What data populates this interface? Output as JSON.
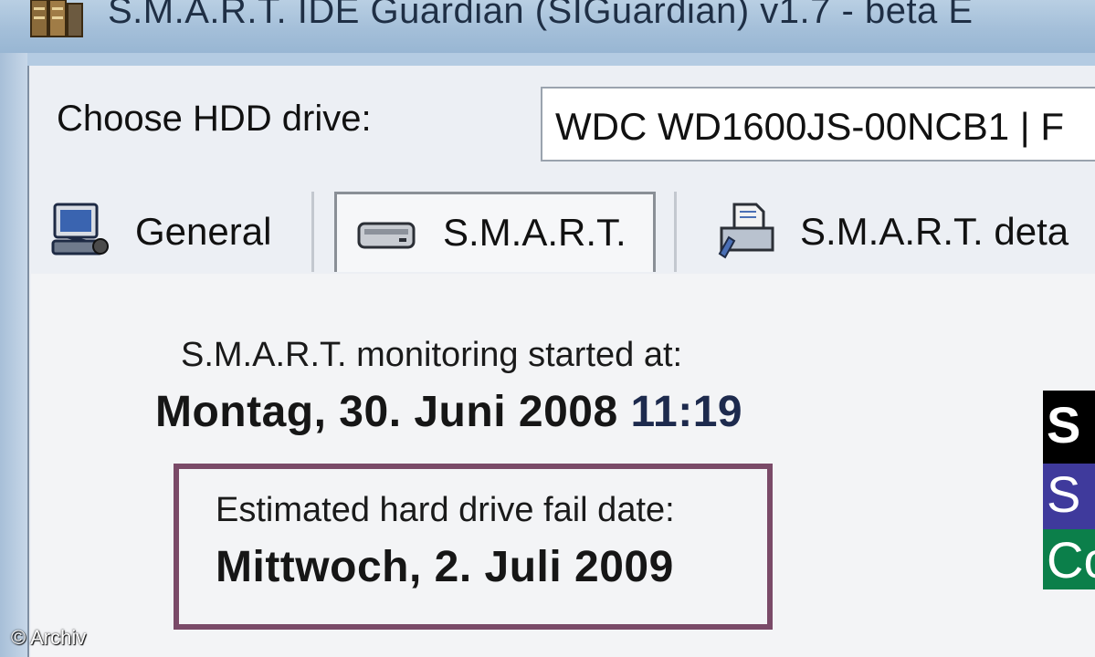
{
  "window": {
    "title": "S.M.A.R.T. IDE Guardian (SIGuardian) v1.7 - beta E"
  },
  "drive_selector": {
    "label": "Choose HDD drive:",
    "selected": "WDC WD1600JS-00NCB1  |  F"
  },
  "tabs": [
    {
      "label": "General",
      "icon": "monitor-network-icon",
      "active": false
    },
    {
      "label": "S.M.A.R.T.",
      "icon": "hard-drive-icon",
      "active": true
    },
    {
      "label": "S.M.A.R.T. deta",
      "icon": "printer-report-icon",
      "active": false
    }
  ],
  "monitoring": {
    "label": "S.M.A.R.T. monitoring started at:",
    "date": "Montag, 30. Juni 2008",
    "time": "11:19"
  },
  "fail_estimate": {
    "label": "Estimated hard drive fail date:",
    "date": "Mittwoch, 2. Juli 2009"
  },
  "logo": {
    "letters": [
      "S",
      "S",
      "Co"
    ],
    "colors": [
      "#000000",
      "#3f3a9c",
      "#0b7f4a"
    ]
  },
  "watermark": "© Archiv",
  "colors": {
    "fail_box_border": "#7a4a68",
    "titlebar": "#a4bfd9"
  }
}
